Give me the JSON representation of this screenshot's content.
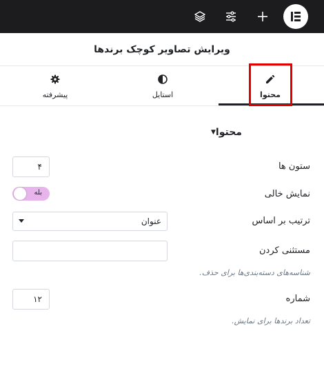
{
  "topbar": {
    "icons": [
      "layers-icon",
      "sliders-icon",
      "plus-icon",
      "elementor-logo-icon"
    ]
  },
  "header": {
    "title": "ویرایش تصاویر کوچک برندها"
  },
  "tabs": [
    {
      "label": "محتوا",
      "icon": "pencil-icon",
      "active": true
    },
    {
      "label": "استایل",
      "icon": "half-circle-icon",
      "active": false
    },
    {
      "label": "پیشرفته",
      "icon": "gear-icon",
      "active": false
    }
  ],
  "section": {
    "title": "محتوا"
  },
  "fields": {
    "columns": {
      "label": "ستون ها",
      "value": "۴"
    },
    "show_empty": {
      "label": "نمایش خالی",
      "toggle_text": "بله"
    },
    "order_by": {
      "label": "ترتیب بر اساس",
      "value": "عنوان"
    },
    "exclude": {
      "label": "مستثنی کردن",
      "value": "",
      "help": "شناسه‌های دسته‌بندی‌ها برای حذف."
    },
    "number": {
      "label": "شماره",
      "value": "۱۲",
      "help": "تعداد برندها برای نمایش."
    }
  },
  "colors": {
    "topbar": "#1c1c1e",
    "highlight": "#e00000",
    "toggle": "#e7b4ec"
  }
}
